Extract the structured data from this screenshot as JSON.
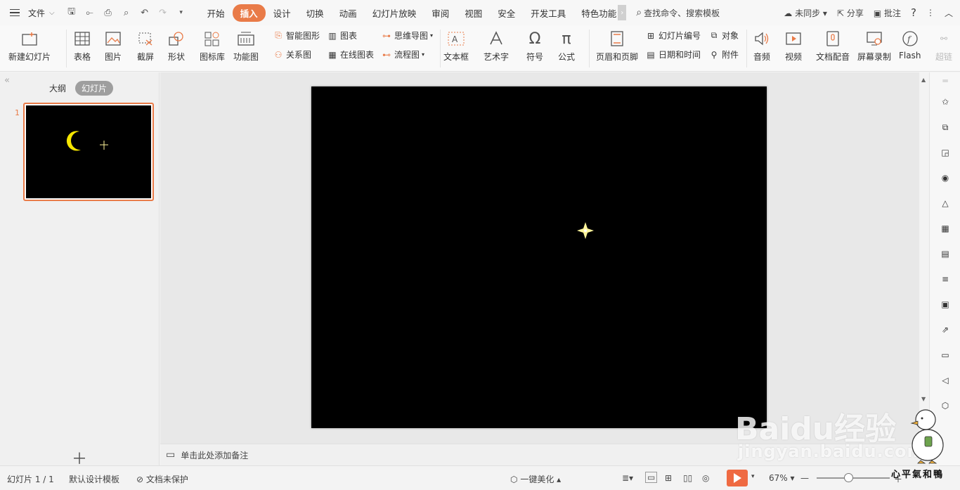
{
  "menu": {
    "file_label": "文件"
  },
  "tabs": [
    "开始",
    "插入",
    "设计",
    "切换",
    "动画",
    "幻灯片放映",
    "审阅",
    "视图",
    "安全",
    "开发工具",
    "特色功能"
  ],
  "active_tab_index": 1,
  "search_label": "查找命令、搜索模板",
  "topright": {
    "sync": "未同步",
    "share": "分享",
    "comment": "批注",
    "help": "?"
  },
  "ribbon": {
    "new_slide": "新建幻灯片",
    "table": "表格",
    "picture": "图片",
    "screenshot": "截屏",
    "shape": "形状",
    "icon_lib": "图标库",
    "function_chart": "功能图",
    "smart_shape": "智能图形",
    "chart": "图表",
    "relation_chart": "关系图",
    "online_chart": "在线图表",
    "mind_map": "思维导图",
    "flow_chart": "流程图",
    "text_box": "文本框",
    "art_text": "艺术字",
    "symbol": "符号",
    "formula": "公式",
    "header_footer": "页眉和页脚",
    "slide_number": "幻灯片编号",
    "object": "对象",
    "date_time": "日期和时间",
    "attachment": "附件",
    "audio": "音频",
    "video": "视频",
    "doc_dub": "文档配音",
    "screen_record": "屏幕录制",
    "flash": "Flash",
    "hyperlink": "超链"
  },
  "panel": {
    "outline": "大纲",
    "slides": "幻灯片",
    "thumb_number": "1"
  },
  "notes_placeholder": "单击此处添加备注",
  "status": {
    "slide_count": "幻灯片 1 / 1",
    "template": "默认设计模板",
    "protect": "文档未保护",
    "beautify": "一键美化",
    "zoom": "67%"
  },
  "watermark": {
    "brand": "Baidu经验",
    "url": "jingyan.baidu.com",
    "corner": "心平氣和鴨"
  },
  "colors": {
    "accent": "#e97b48",
    "moon": "#f5e600",
    "star": "#fff59a",
    "slide_bg": "#000000"
  }
}
